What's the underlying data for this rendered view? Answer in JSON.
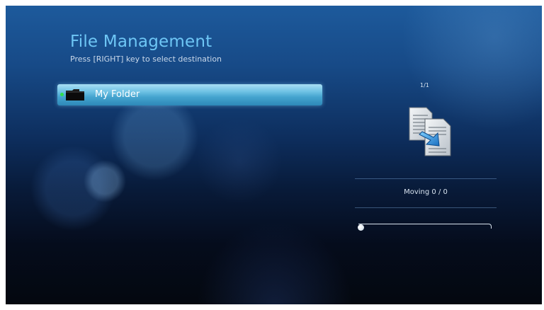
{
  "header": {
    "title": "File Management",
    "subtitle": "Press [RIGHT] key to select destination"
  },
  "folder_list": {
    "items": [
      {
        "label": "My Folder",
        "icon": "folder-icon",
        "selected": true
      }
    ]
  },
  "info_panel": {
    "page_indicator": "1/1",
    "operation_icon": "copy-documents-icon",
    "status": "Moving 0 / 0",
    "progress": 0
  },
  "colors": {
    "title": "#6ec6f5",
    "selection_highlight": "#6fc2e4",
    "bullet": "#2fe14a"
  }
}
